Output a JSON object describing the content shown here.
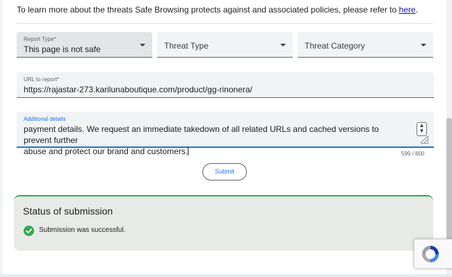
{
  "intro": {
    "text": "To learn more about the threats Safe Browsing protects against and associated policies, please refer to ",
    "link": "here",
    "suffix": "."
  },
  "form": {
    "report_type": {
      "label": "Report Type*",
      "value": "This page is not safe"
    },
    "threat_type": {
      "placeholder": "Threat Type"
    },
    "threat_category": {
      "placeholder": "Threat Category"
    },
    "url": {
      "label": "URL to report*",
      "value": "https://rajastar-273.karilunaboutique.com/product/gg-rinonera/"
    },
    "details": {
      "label": "Additional details",
      "line1": "payment details. We request an immediate takedown of all related URLs and cached versions to prevent further",
      "line2": "abuse and protect our brand and customers."
    },
    "char_counter": "599 / 800",
    "submit_label": "Submit"
  },
  "status": {
    "title": "Status of submission",
    "message": "Submission was successful.",
    "color": "#34a853"
  },
  "colors": {
    "accent": "#1a73e8",
    "link": "#1a0dab",
    "success": "#34a853"
  },
  "icons": [
    "dropdown-caret-icon",
    "spinner-arrows-icon",
    "resize-handle-icon",
    "check-circle-icon",
    "recaptcha-logo-icon"
  ]
}
